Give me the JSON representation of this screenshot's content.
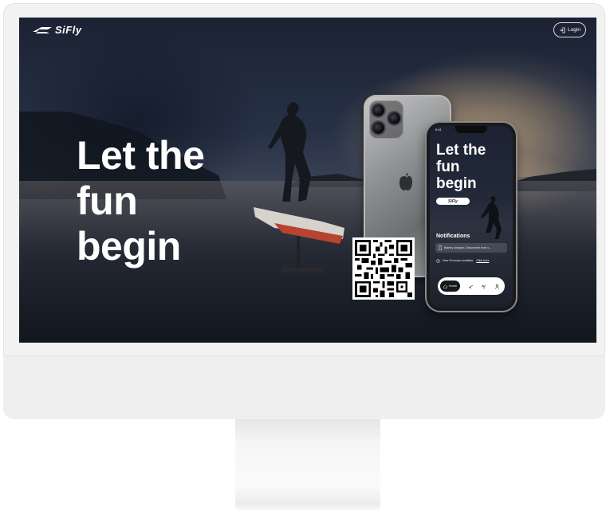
{
  "header": {
    "brand": "SiFly",
    "login_label": "Login"
  },
  "hero": {
    "lines": [
      "Let the",
      "fun",
      "begin"
    ]
  },
  "phone": {
    "status_time": "9:41",
    "title_lines": [
      "Let the",
      "fun",
      "begin"
    ],
    "brand": "SiFly",
    "notifications_title": "Notifications",
    "notification_1": "Battery charged. Disconnect from c...",
    "notification_2_text": "New Firmware available.",
    "notification_2_link": "Click here",
    "tab_home": "Home"
  },
  "colors": {
    "screen_bg": "#1b2233",
    "text": "#ffffff",
    "device_frame": "#f2f2f2"
  },
  "icons": [
    "login-icon",
    "apple-icon",
    "battery-icon",
    "firmware-icon",
    "home-icon",
    "foil-icon",
    "stats-icon",
    "profile-icon",
    "qr-code"
  ]
}
